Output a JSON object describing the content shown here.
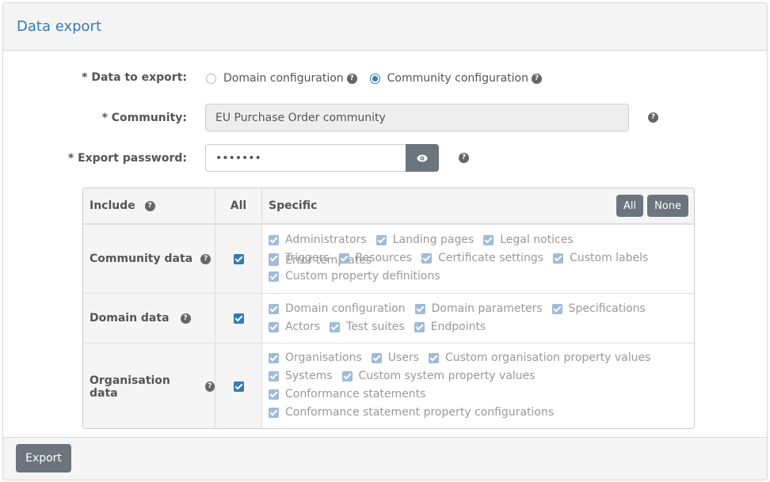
{
  "panel": {
    "title": "Data export"
  },
  "form": {
    "data_to_export_label": "* Data to export:",
    "option_domain": "Domain configuration",
    "option_community": "Community configuration",
    "selected_option": "community",
    "community_label": "* Community:",
    "community_value": "EU Purchase Order community",
    "password_label": "* Export password:",
    "password_value": "•••••••"
  },
  "table": {
    "header": {
      "include": "Include",
      "all": "All",
      "specific": "Specific",
      "all_button": "All",
      "none_button": "None"
    },
    "rows": [
      {
        "label": "Community data",
        "all_checked": true,
        "lines": [
          [
            "Administrators",
            "Landing pages",
            "Legal notices",
            "Error templates"
          ],
          [
            "Triggers",
            "Resources",
            "Certificate settings",
            "Custom labels"
          ],
          [
            "Custom property definitions"
          ]
        ]
      },
      {
        "label": "Domain data",
        "all_checked": true,
        "lines": [
          [
            "Domain configuration",
            "Domain parameters",
            "Specifications"
          ],
          [
            "Actors",
            "Test suites",
            "Endpoints"
          ]
        ]
      },
      {
        "label": "Organisation data",
        "all_checked": true,
        "lines": [
          [
            "Organisations",
            "Users",
            "Custom organisation property values"
          ],
          [
            "Systems",
            "Custom system property values"
          ],
          [
            "Conformance statements"
          ],
          [
            "Conformance statement property configurations"
          ]
        ]
      }
    ]
  },
  "footer": {
    "export_button": "Export"
  },
  "colors": {
    "accent": "#337ab7",
    "button": "#6c757d"
  }
}
